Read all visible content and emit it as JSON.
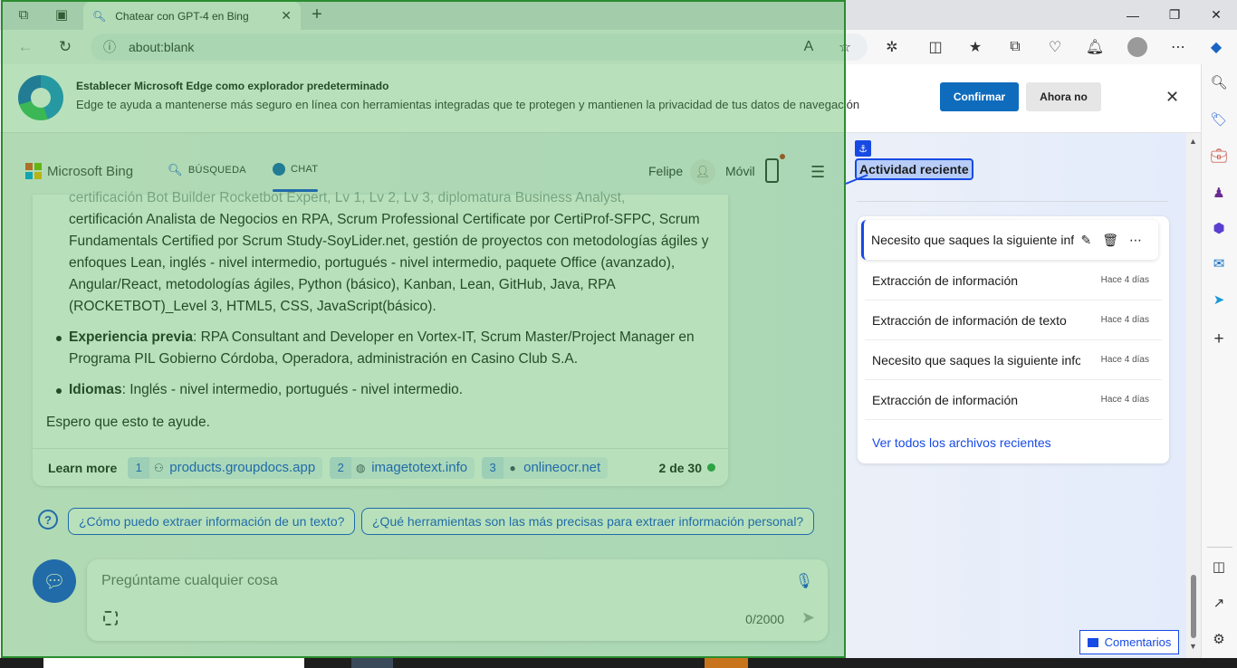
{
  "browser": {
    "tab_title": "Chatear con GPT-4 en Bing",
    "address": "about:blank"
  },
  "default_bar": {
    "title": "Establecer Microsoft Edge como explorador predeterminado",
    "description": "Edge te ayuda a mantenerse más seguro en línea con herramientas integradas que te protegen y mantienen la privacidad de tus datos de navegación",
    "confirm_label": "Confirmar",
    "later_label": "Ahora no"
  },
  "bing": {
    "logo_text": "Microsoft Bing",
    "tab_search": "BÚSQUEDA",
    "tab_chat": "CHAT",
    "user_name": "Felipe",
    "mobile_label": "Móvil"
  },
  "answer": {
    "line_faded": "certificación Bot Builder Rocketbot Expert, Lv 1, Lv 2, Lv 3, diplomatura Business Analyst,",
    "paragraph": "certificación Analista de Negocios en RPA, Scrum Professional Certificate por CertiProf-SFPC, Scrum Fundamentals Certified por Scrum Study-SoyLider.net, gestión de proyectos con metodologías ágiles y enfoques Lean, inglés - nivel intermedio, portugués - nivel intermedio, paquete Office (avanzado), Angular/React, metodologías ágiles, Python (básico), Kanban, Lean, GitHub, Java, RPA (ROCKETBOT)_Level 3, HTML5, CSS, JavaScript(básico).",
    "bullets": [
      {
        "label": "Experiencia previa",
        "text": ": RPA Consultant and Developer en Vortex-IT, Scrum Master/Project Manager en Programa PIL Gobierno Córdoba, Operadora, administración en Casino Club S.A."
      },
      {
        "label": "Idiomas",
        "text": ": Inglés - nivel intermedio, portugués - nivel intermedio."
      }
    ],
    "closing": "Espero que esto te ayude.",
    "learn_more": "Learn more",
    "sources": [
      {
        "num": "1",
        "name": "products.groupdocs.app"
      },
      {
        "num": "2",
        "name": "imagetotext.info"
      },
      {
        "num": "3",
        "name": "onlineocr.net"
      }
    ],
    "counter": "2 de 30"
  },
  "suggestions": [
    "¿Cómo puedo extraer información de un texto?",
    "¿Qué herramientas son las más precisas para extraer información personal?"
  ],
  "input": {
    "placeholder": "Pregúntame cualquier cosa",
    "char_count": "0/2000"
  },
  "recent": {
    "title": "Actividad reciente",
    "items": [
      {
        "title": "Necesito que saques la siguiente información",
        "time": ""
      },
      {
        "title": "Extracción de información",
        "time": "Hace 4 días"
      },
      {
        "title": "Extracción de información de texto",
        "time": "Hace 4 días"
      },
      {
        "title": "Necesito que saques la siguiente información",
        "time": "Hace 4 días"
      },
      {
        "title": "Extracción de información",
        "time": "Hace 4 días"
      }
    ],
    "see_all": "Ver todos los archivos recientes"
  },
  "feedback_label": "Comentarios",
  "colors": {
    "accent": "#174ae4",
    "edge_blue": "#0f6cbd",
    "overlay_green": "#34a83b"
  }
}
